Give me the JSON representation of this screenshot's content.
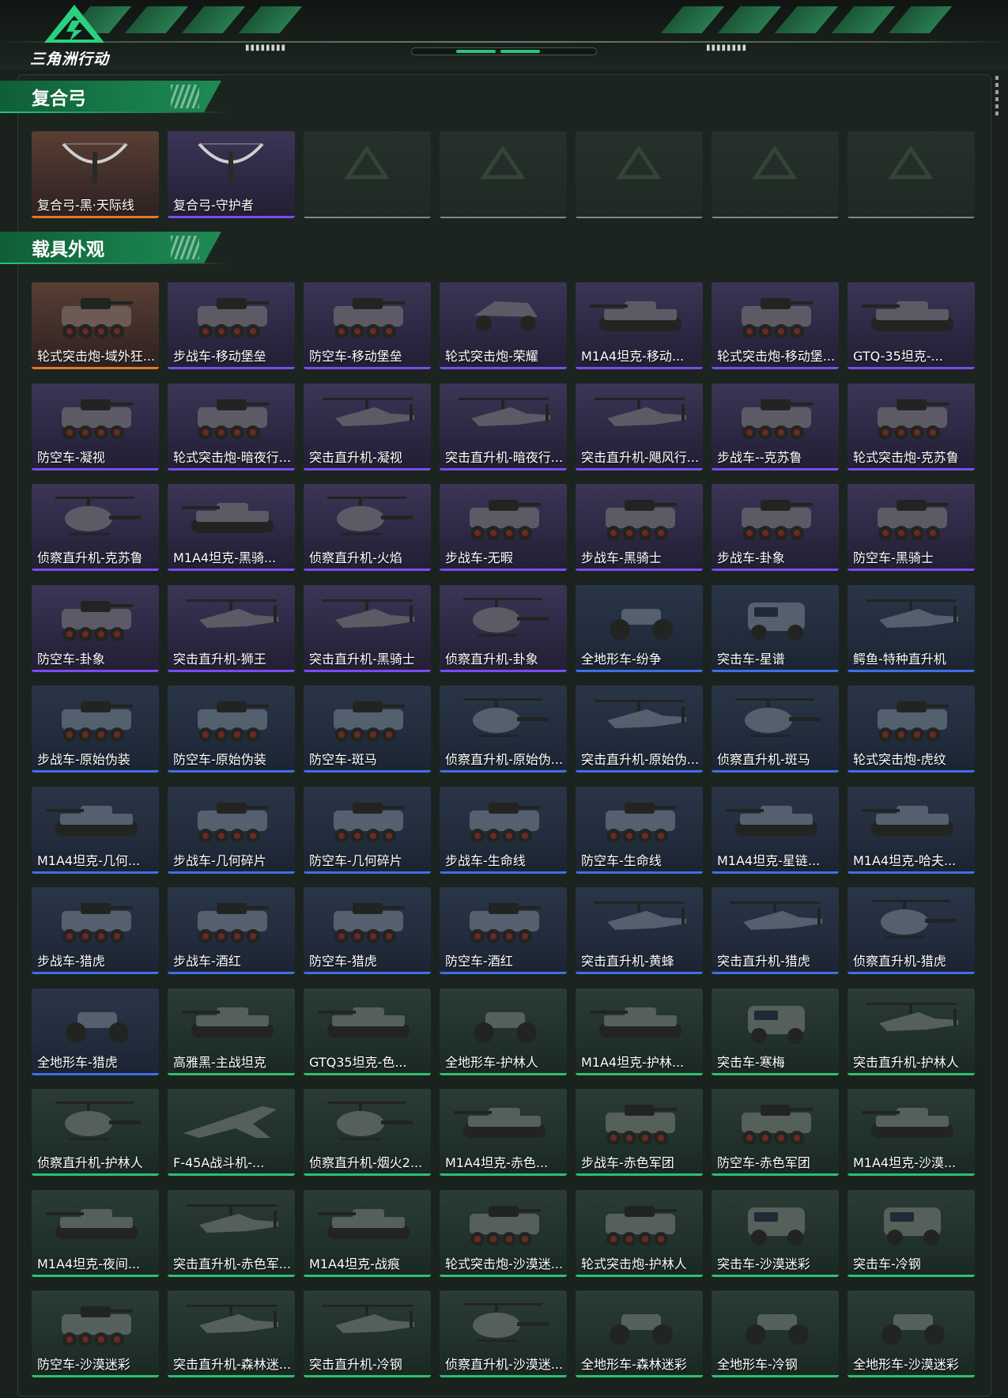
{
  "app": {
    "logo_text": "三角洲行动"
  },
  "sections": [
    {
      "title": "复合弓",
      "items": [
        {
          "label": "复合弓-黑·天际线",
          "rarity": "gold",
          "kind": "bow"
        },
        {
          "label": "复合弓-守护者",
          "rarity": "purple",
          "kind": "bow"
        },
        {
          "label": "",
          "rarity": "empty",
          "kind": "placeholder"
        },
        {
          "label": "",
          "rarity": "empty",
          "kind": "placeholder"
        },
        {
          "label": "",
          "rarity": "empty",
          "kind": "placeholder"
        },
        {
          "label": "",
          "rarity": "empty",
          "kind": "placeholder"
        },
        {
          "label": "",
          "rarity": "empty",
          "kind": "placeholder"
        }
      ]
    },
    {
      "title": "载具外观",
      "items": [
        {
          "label": "轮式突击炮-域外狂...",
          "rarity": "gold",
          "kind": "apc"
        },
        {
          "label": "步战车-移动堡垒",
          "rarity": "purple",
          "kind": "apc"
        },
        {
          "label": "防空车-移动堡垒",
          "rarity": "purple",
          "kind": "apc"
        },
        {
          "label": "轮式突击炮-荣耀",
          "rarity": "purple",
          "kind": "buggy"
        },
        {
          "label": "M1A4坦克-移动...",
          "rarity": "purple",
          "kind": "tank"
        },
        {
          "label": "轮式突击炮-移动堡...",
          "rarity": "purple",
          "kind": "apc"
        },
        {
          "label": "GTQ-35坦克-...",
          "rarity": "purple",
          "kind": "tank"
        },
        {
          "label": "防空车-凝视",
          "rarity": "purple",
          "kind": "apc"
        },
        {
          "label": "轮式突击炮-暗夜行...",
          "rarity": "purple",
          "kind": "apc"
        },
        {
          "label": "突击直升机-凝视",
          "rarity": "purple",
          "kind": "heli"
        },
        {
          "label": "突击直升机-暗夜行...",
          "rarity": "purple",
          "kind": "heli"
        },
        {
          "label": "突击直升机-飓风行...",
          "rarity": "purple",
          "kind": "heli"
        },
        {
          "label": "步战车--克苏鲁",
          "rarity": "purple",
          "kind": "apc"
        },
        {
          "label": "轮式突击炮-克苏鲁",
          "rarity": "purple",
          "kind": "apc"
        },
        {
          "label": "侦察直升机-克苏鲁",
          "rarity": "purple",
          "kind": "smallheli"
        },
        {
          "label": "M1A4坦克-黑骑...",
          "rarity": "purple",
          "kind": "tank"
        },
        {
          "label": "侦察直升机-火焰",
          "rarity": "purple",
          "kind": "smallheli"
        },
        {
          "label": "步战车-无暇",
          "rarity": "purple",
          "kind": "apc"
        },
        {
          "label": "步战车-黑骑士",
          "rarity": "purple",
          "kind": "apc"
        },
        {
          "label": "步战车-卦象",
          "rarity": "purple",
          "kind": "apc"
        },
        {
          "label": "防空车-黑骑士",
          "rarity": "purple",
          "kind": "apc"
        },
        {
          "label": "防空车-卦象",
          "rarity": "purple",
          "kind": "apc"
        },
        {
          "label": "突击直升机-狮王",
          "rarity": "purple",
          "kind": "heli"
        },
        {
          "label": "突击直升机-黑骑士",
          "rarity": "purple",
          "kind": "heli"
        },
        {
          "label": "侦察直升机-卦象",
          "rarity": "purple",
          "kind": "smallheli"
        },
        {
          "label": "全地形车-纷争",
          "rarity": "blue",
          "kind": "atv"
        },
        {
          "label": "突击车-星谱",
          "rarity": "blue",
          "kind": "truck"
        },
        {
          "label": "鳄鱼-特种直升机",
          "rarity": "blue",
          "kind": "heli"
        },
        {
          "label": "步战车-原始伪装",
          "rarity": "blue",
          "kind": "apc"
        },
        {
          "label": "防空车-原始伪装",
          "rarity": "blue",
          "kind": "apc"
        },
        {
          "label": "防空车-斑马",
          "rarity": "blue",
          "kind": "apc"
        },
        {
          "label": "侦察直升机-原始伪...",
          "rarity": "blue",
          "kind": "smallheli"
        },
        {
          "label": "突击直升机-原始伪...",
          "rarity": "blue",
          "kind": "heli"
        },
        {
          "label": "侦察直升机-斑马",
          "rarity": "blue",
          "kind": "smallheli"
        },
        {
          "label": "轮式突击炮-虎纹",
          "rarity": "blue",
          "kind": "apc"
        },
        {
          "label": "M1A4坦克-几何...",
          "rarity": "blue",
          "kind": "tank"
        },
        {
          "label": "步战车-几何碎片",
          "rarity": "blue",
          "kind": "apc"
        },
        {
          "label": "防空车-几何碎片",
          "rarity": "blue",
          "kind": "apc"
        },
        {
          "label": "步战车-生命线",
          "rarity": "blue",
          "kind": "apc"
        },
        {
          "label": "防空车-生命线",
          "rarity": "blue",
          "kind": "apc"
        },
        {
          "label": "M1A4坦克-星链...",
          "rarity": "blue",
          "kind": "tank"
        },
        {
          "label": "M1A4坦克-哈夫...",
          "rarity": "blue",
          "kind": "tank"
        },
        {
          "label": "步战车-猎虎",
          "rarity": "blue",
          "kind": "apc"
        },
        {
          "label": "步战车-酒红",
          "rarity": "blue",
          "kind": "apc"
        },
        {
          "label": "防空车-猎虎",
          "rarity": "blue",
          "kind": "apc"
        },
        {
          "label": "防空车-酒红",
          "rarity": "blue",
          "kind": "apc"
        },
        {
          "label": "突击直升机-黄蜂",
          "rarity": "blue",
          "kind": "heli"
        },
        {
          "label": "突击直升机-猎虎",
          "rarity": "blue",
          "kind": "heli"
        },
        {
          "label": "侦察直升机-猎虎",
          "rarity": "blue",
          "kind": "smallheli"
        },
        {
          "label": "全地形车-猎虎",
          "rarity": "blue",
          "kind": "atv"
        },
        {
          "label": "高雅黑-主战坦克",
          "rarity": "green",
          "kind": "tank"
        },
        {
          "label": "GTQ35坦克-色...",
          "rarity": "green",
          "kind": "tank"
        },
        {
          "label": "全地形车-护林人",
          "rarity": "green",
          "kind": "atv"
        },
        {
          "label": "M1A4坦克-护林...",
          "rarity": "green",
          "kind": "tank"
        },
        {
          "label": "突击车-寒梅",
          "rarity": "green",
          "kind": "truck"
        },
        {
          "label": "突击直升机-护林人",
          "rarity": "green",
          "kind": "heli"
        },
        {
          "label": "侦察直升机-护林人",
          "rarity": "green",
          "kind": "smallheli"
        },
        {
          "label": "F-45A战斗机-...",
          "rarity": "green",
          "kind": "jet"
        },
        {
          "label": "侦察直升机-烟火2...",
          "rarity": "green",
          "kind": "smallheli"
        },
        {
          "label": "M1A4坦克-赤色...",
          "rarity": "green",
          "kind": "tank"
        },
        {
          "label": "步战车-赤色军团",
          "rarity": "green",
          "kind": "apc"
        },
        {
          "label": "防空车-赤色军团",
          "rarity": "green",
          "kind": "apc"
        },
        {
          "label": "M1A4坦克-沙漠...",
          "rarity": "green",
          "kind": "tank"
        },
        {
          "label": "M1A4坦克-夜间...",
          "rarity": "green",
          "kind": "tank"
        },
        {
          "label": "突击直升机-赤色军...",
          "rarity": "green",
          "kind": "heli"
        },
        {
          "label": "M1A4坦克-战痕",
          "rarity": "green",
          "kind": "tank"
        },
        {
          "label": "轮式突击炮-沙漠迷...",
          "rarity": "green",
          "kind": "apc"
        },
        {
          "label": "轮式突击炮-护林人",
          "rarity": "green",
          "kind": "apc"
        },
        {
          "label": "突击车-沙漠迷彩",
          "rarity": "green",
          "kind": "truck"
        },
        {
          "label": "突击车-冷钢",
          "rarity": "green",
          "kind": "truck"
        },
        {
          "label": "防空车-沙漠迷彩",
          "rarity": "green",
          "kind": "apc"
        },
        {
          "label": "突击直升机-森林迷...",
          "rarity": "green",
          "kind": "heli"
        },
        {
          "label": "突击直升机-冷钢",
          "rarity": "green",
          "kind": "heli"
        },
        {
          "label": "侦察直升机-沙漠迷...",
          "rarity": "green",
          "kind": "smallheli"
        },
        {
          "label": "全地形车-森林迷彩",
          "rarity": "green",
          "kind": "atv"
        },
        {
          "label": "全地形车-冷钢",
          "rarity": "green",
          "kind": "atv"
        },
        {
          "label": "全地形车-沙漠迷彩",
          "rarity": "green",
          "kind": "atv"
        }
      ]
    }
  ],
  "colors": {
    "gold": "#e07a2b",
    "purple": "#7a4cf0",
    "blue": "#3f6fe6",
    "green": "#2cc06d",
    "accent": "#27c679"
  }
}
